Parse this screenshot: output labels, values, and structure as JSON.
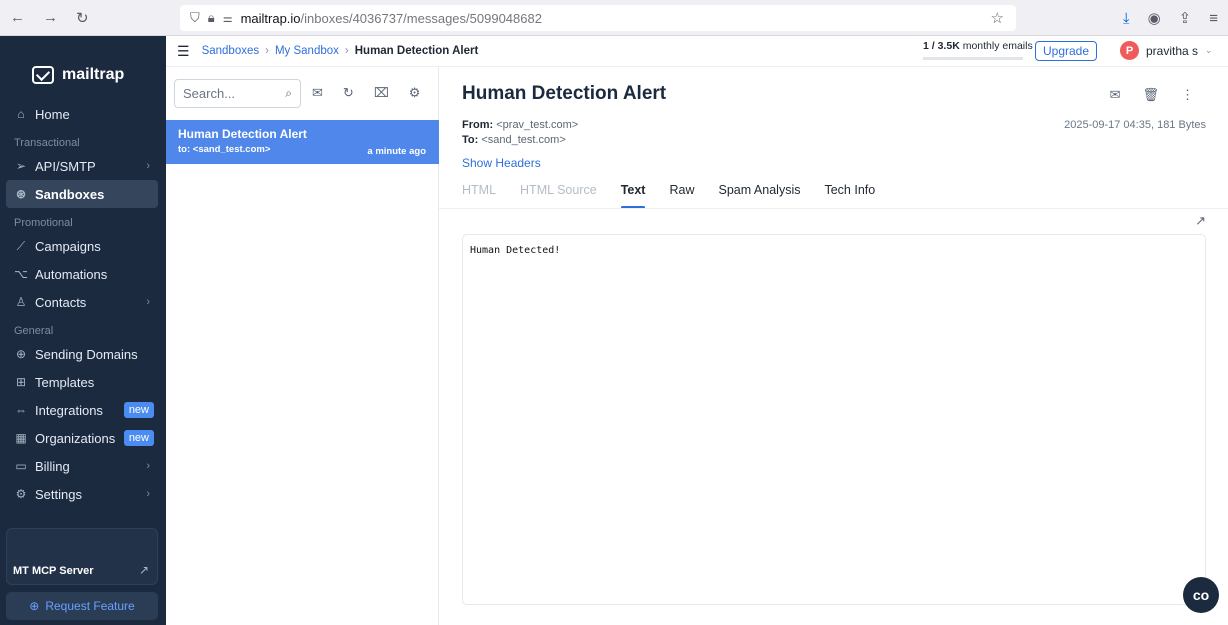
{
  "browser": {
    "back": "←",
    "forward": "→",
    "reload": "↻",
    "url_host": "mailtrap.io",
    "url_path": "/inboxes/4036737/messages/5099048682"
  },
  "sidebar": {
    "brand": "mailtrap",
    "home": "Home",
    "section_transactional": "Transactional",
    "api_smtp": "API/SMTP",
    "sandboxes": "Sandboxes",
    "section_promotional": "Promotional",
    "campaigns": "Campaigns",
    "automations": "Automations",
    "contacts": "Contacts",
    "section_general": "General",
    "sending_domains": "Sending Domains",
    "templates": "Templates",
    "integrations": "Integrations",
    "organizations": "Organizations",
    "billing": "Billing",
    "settings": "Settings",
    "new_badge": "new",
    "mcp_server": "MT MCP Server",
    "request_feature": "Request Feature"
  },
  "topbar": {
    "crumb_1": "Sandboxes",
    "crumb_2": "My Sandbox",
    "crumb_3": "Human Detection Alert",
    "usage_value": "1 / 3.5K",
    "usage_label": "monthly emails",
    "upgrade": "Upgrade",
    "avatar_letter": "P",
    "user_name": "pravitha s"
  },
  "list": {
    "search_placeholder": "Search...",
    "message": {
      "subject": "Human Detection Alert",
      "to": "to: <sand_test.com>",
      "time": "a minute ago"
    }
  },
  "message": {
    "title": "Human Detection Alert",
    "from_label": "From:",
    "from_value": "<prav_test.com>",
    "to_label": "To:",
    "to_value": "<sand_test.com>",
    "meta": "2025-09-17 04:35, 181 Bytes",
    "show_headers": "Show Headers",
    "tabs": [
      "HTML",
      "HTML Source",
      "Text",
      "Raw",
      "Spam Analysis",
      "Tech Info"
    ],
    "body": "Human Detected!"
  },
  "chat_label": "co"
}
